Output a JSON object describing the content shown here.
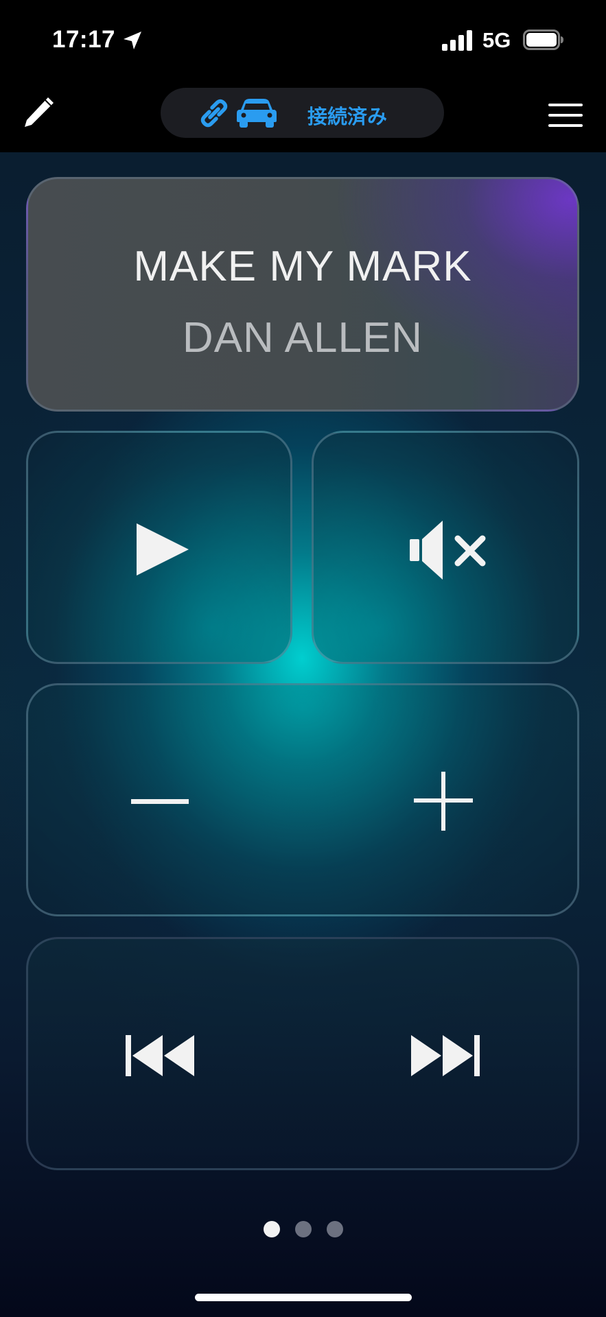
{
  "status_bar": {
    "time": "17:17",
    "network": "5G",
    "icons": [
      "location-arrow-icon",
      "signal-bars-icon",
      "battery-icon"
    ]
  },
  "nav": {
    "edit_icon": "pencil-icon",
    "menu_icon": "hamburger-menu-icon",
    "connection": {
      "icons": [
        "link-icon",
        "car-icon"
      ],
      "label": "接続済み",
      "color": "#2a9cf0"
    }
  },
  "now_playing": {
    "title": "MAKE MY MARK",
    "artist": "DAN ALLEN"
  },
  "controls": {
    "play_icon": "play-icon",
    "mute_icon": "speaker-mute-icon",
    "volume_down_icon": "minus-icon",
    "volume_up_icon": "plus-icon",
    "previous_icon": "skip-previous-icon",
    "next_icon": "skip-next-icon"
  },
  "pager": {
    "count": 3,
    "active_index": 0
  },
  "colors": {
    "accent_blue": "#2a9cf0",
    "glow_cyan": "#00d7d7",
    "purple_highlight": "#6e37c8"
  }
}
